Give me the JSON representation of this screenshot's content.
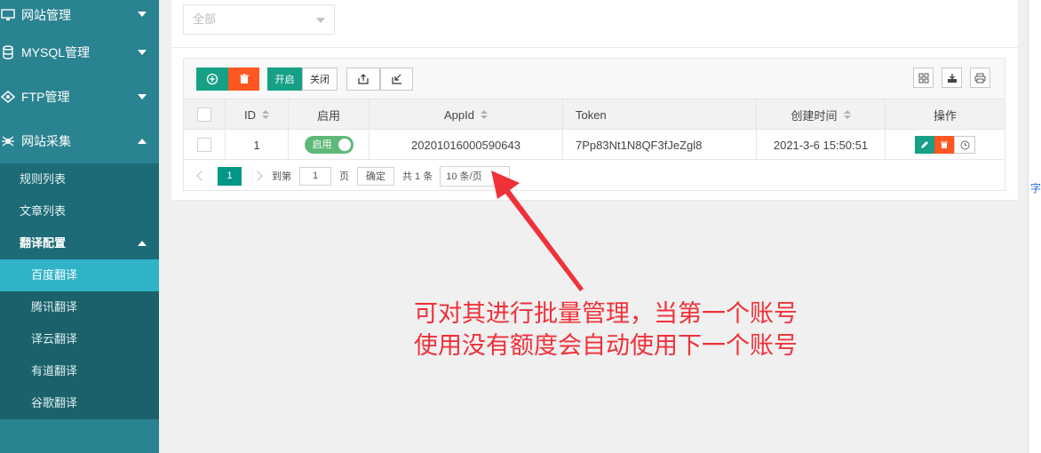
{
  "sidebar": {
    "nav": [
      {
        "label": "网站管理",
        "expanded": false
      },
      {
        "label": "MYSQL管理",
        "expanded": false
      },
      {
        "label": "FTP管理",
        "expanded": false
      },
      {
        "label": "网站采集",
        "expanded": true
      }
    ],
    "sub_items": [
      {
        "label": "规则列表"
      },
      {
        "label": "文章列表"
      },
      {
        "label": "翻译配置",
        "expanded": true
      }
    ],
    "translate_items": [
      {
        "label": "百度翻译",
        "active": true
      },
      {
        "label": "腾讯翻译"
      },
      {
        "label": "译云翻译"
      },
      {
        "label": "有道翻译"
      },
      {
        "label": "谷歌翻译"
      }
    ]
  },
  "filter": {
    "select_value": "全部"
  },
  "toolbar": {
    "on_label": "开启",
    "off_label": "关闭"
  },
  "table": {
    "headers": {
      "id": "ID",
      "enabled": "启用",
      "appid": "AppId",
      "token": "Token",
      "created": "创建时间",
      "actions": "操作"
    },
    "rows": [
      {
        "id": "1",
        "enabled_label": "启用",
        "appid": "20201016000590643",
        "token": "7Pp83Nt1N8QF3fJeZgl8",
        "created": "2021-3-6 15:50:51"
      }
    ]
  },
  "pager": {
    "current": "1",
    "goto_label": "到第",
    "goto_value": "1",
    "page_label": "页",
    "ok_label": "确定",
    "total": "共 1 条",
    "page_size": "10 条/页"
  },
  "annotation": {
    "line1": "可对其进行批量管理，当第一个账号",
    "line2": "使用没有额度会自动使用下一个账号"
  },
  "right_edge": {
    "char": "字"
  },
  "colors": {
    "sidebar": "#2a8390",
    "active": "#2eb3c7",
    "green": "#16a085",
    "orange": "#ff5722",
    "annotation": "#f0313a"
  }
}
